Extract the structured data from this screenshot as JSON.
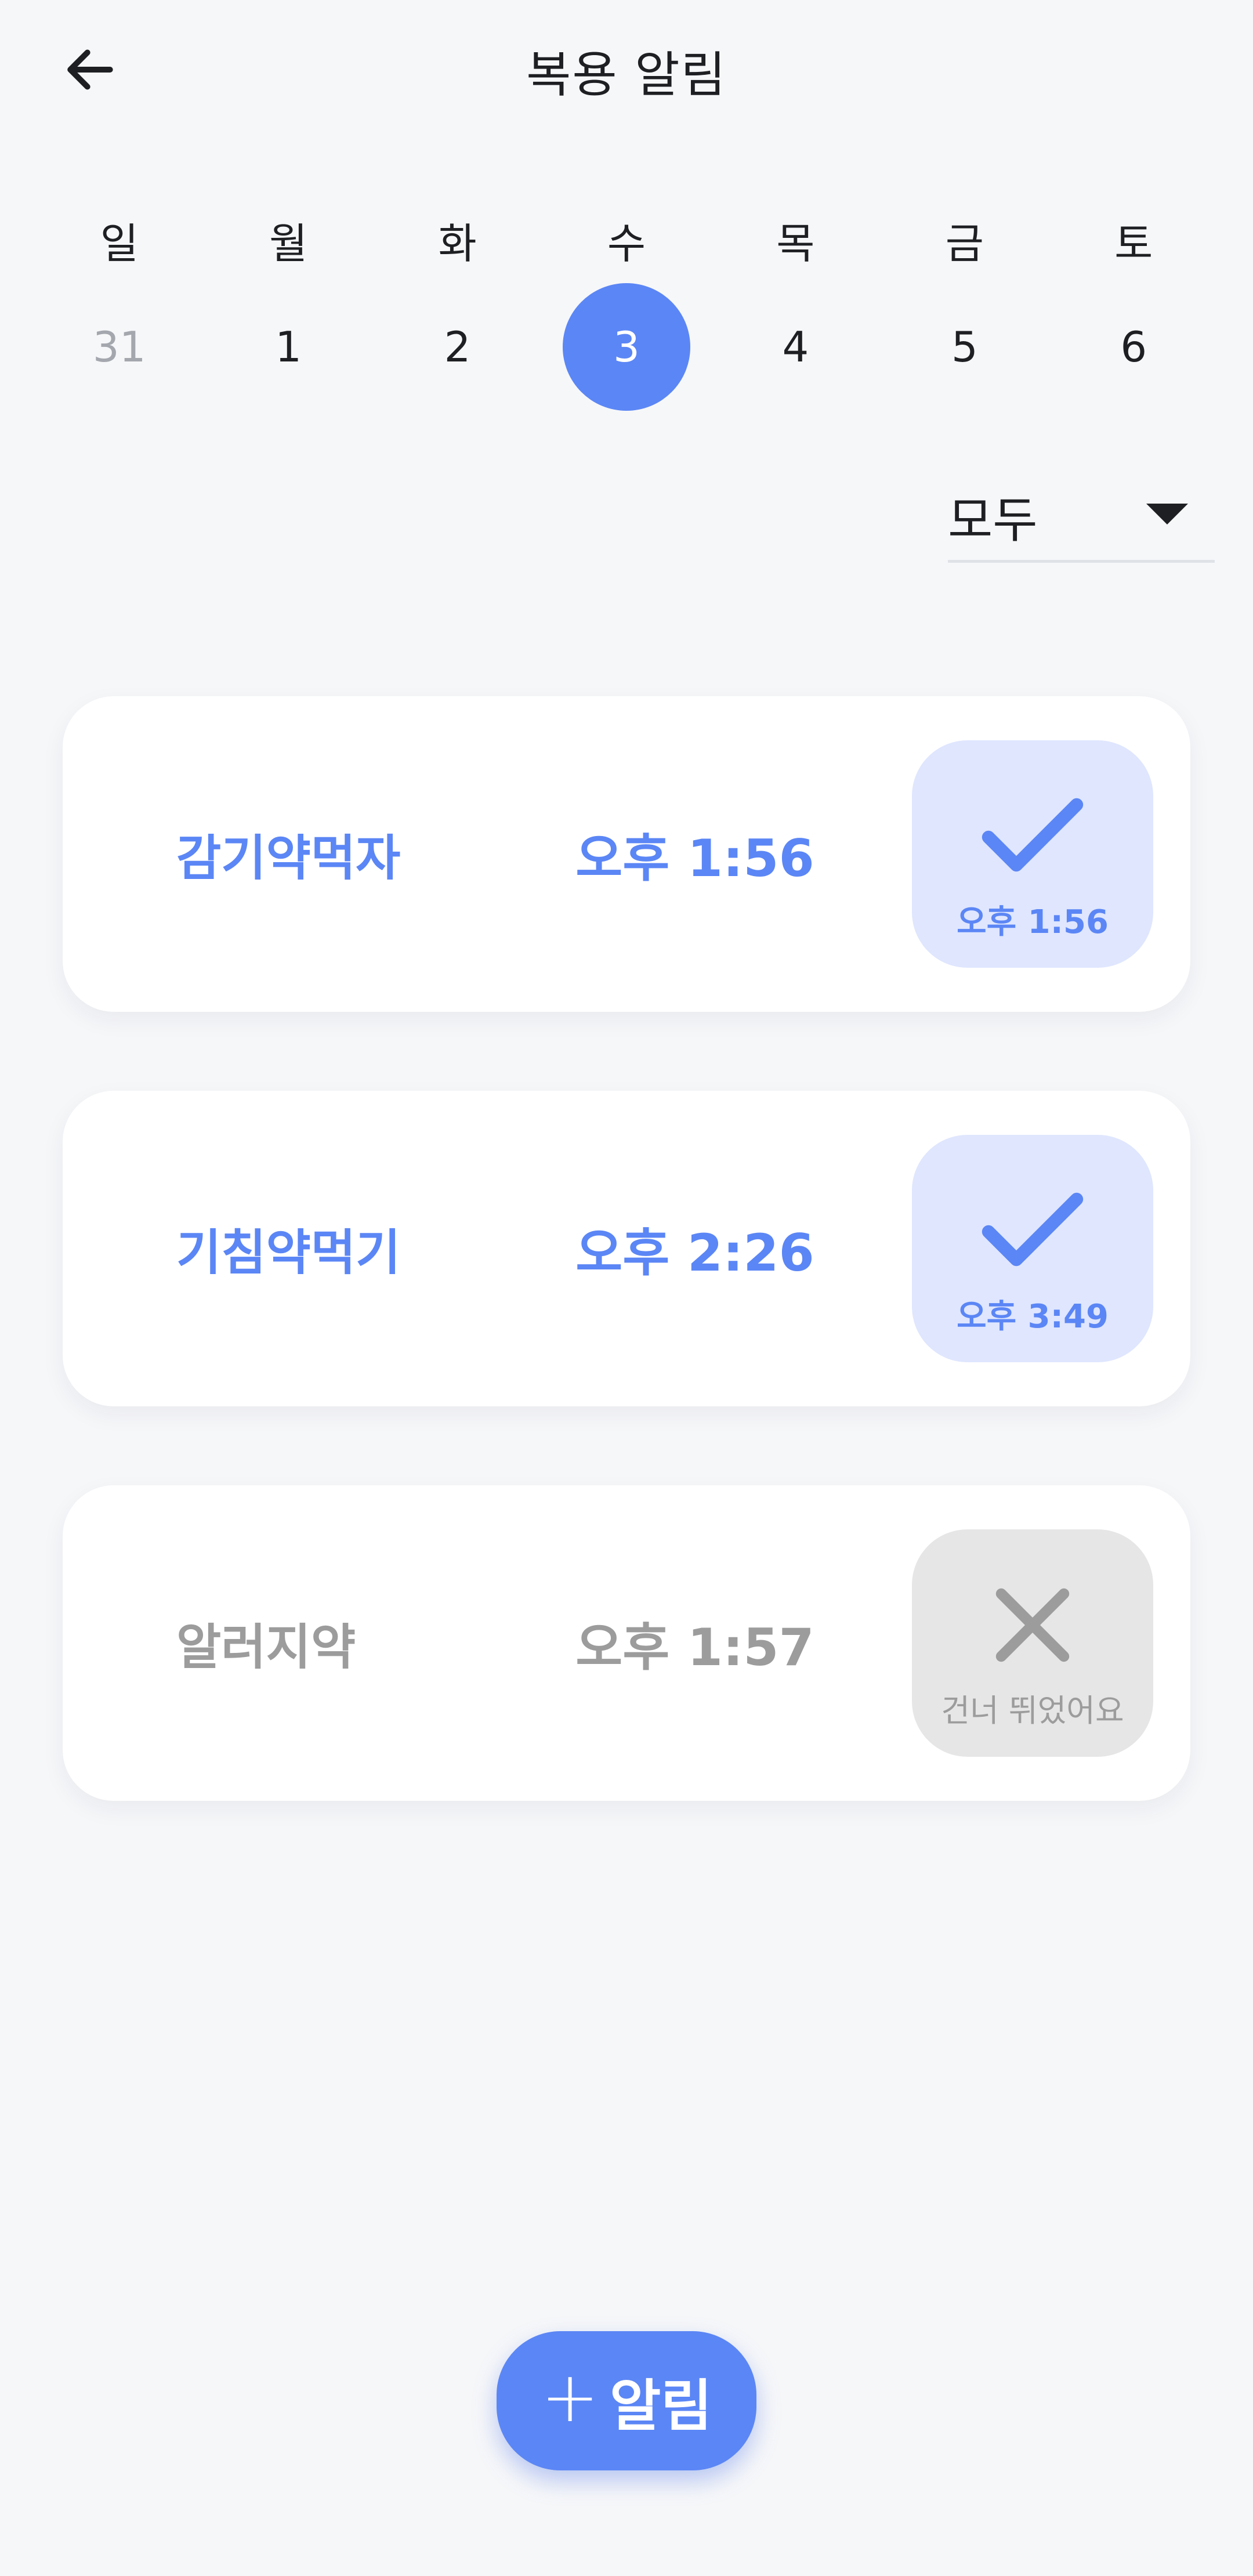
{
  "header": {
    "title": "복용 알림",
    "back_icon": "arrow-left-icon"
  },
  "week": [
    {
      "day": "일",
      "date": "31",
      "state": "muted"
    },
    {
      "day": "월",
      "date": "1",
      "state": "normal"
    },
    {
      "day": "화",
      "date": "2",
      "state": "normal"
    },
    {
      "day": "수",
      "date": "3",
      "state": "selected"
    },
    {
      "day": "목",
      "date": "4",
      "state": "normal"
    },
    {
      "day": "금",
      "date": "5",
      "state": "normal"
    },
    {
      "day": "토",
      "date": "6",
      "state": "normal"
    }
  ],
  "filter": {
    "selected": "모두",
    "icon": "caret-down-icon"
  },
  "reminders": [
    {
      "name": "감기약먹자",
      "time": "오후 1:56",
      "status": "done",
      "status_label": "오후 1:56",
      "status_icon": "check-icon"
    },
    {
      "name": "기침약먹기",
      "time": "오후 2:26",
      "status": "done",
      "status_label": "오후 3:49",
      "status_icon": "check-icon"
    },
    {
      "name": "알러지약",
      "time": "오후 1:57",
      "status": "skipped",
      "status_label": "건너 뛰었어요",
      "status_icon": "close-icon"
    }
  ],
  "fab": {
    "plus": "+",
    "label": "알림"
  },
  "colors": {
    "accent": "#5b86f5",
    "accent_light": "#dfe6fe",
    "muted": "#9c9c9c",
    "skipped_bg": "#e6e6e6",
    "background": "#f6f7f9"
  }
}
